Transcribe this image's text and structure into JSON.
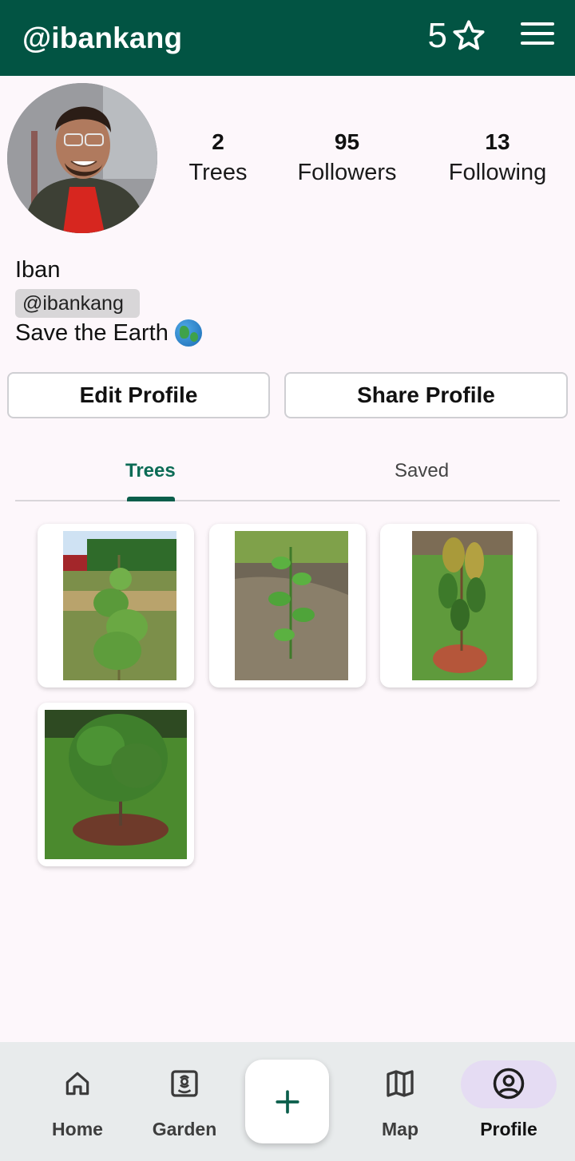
{
  "header": {
    "username": "@ibankang",
    "star_count": "5",
    "star_icon": "star-outline-icon",
    "menu_icon": "hamburger-menu-icon",
    "background": "#025443"
  },
  "profile": {
    "stats": [
      {
        "value": "2",
        "label": "Trees"
      },
      {
        "value": "95",
        "label": "Followers"
      },
      {
        "value": "13",
        "label": "Following"
      }
    ],
    "name": "Iban",
    "handle": "@ibankang",
    "bio": "Save the Earth"
  },
  "actions": {
    "edit_label": "Edit Profile",
    "share_label": "Share Profile"
  },
  "tabs": [
    {
      "label": "Trees",
      "active": true
    },
    {
      "label": "Saved",
      "active": false
    }
  ],
  "accent_color": "#0b6b55",
  "bottom_nav": {
    "items": [
      {
        "label": "Home",
        "icon": "home-icon"
      },
      {
        "label": "Garden",
        "icon": "garden-icon"
      },
      {
        "label": "Map",
        "icon": "map-icon"
      },
      {
        "label": "Profile",
        "icon": "account-circle-icon",
        "active": true
      }
    ],
    "fab_icon": "plus-icon"
  }
}
